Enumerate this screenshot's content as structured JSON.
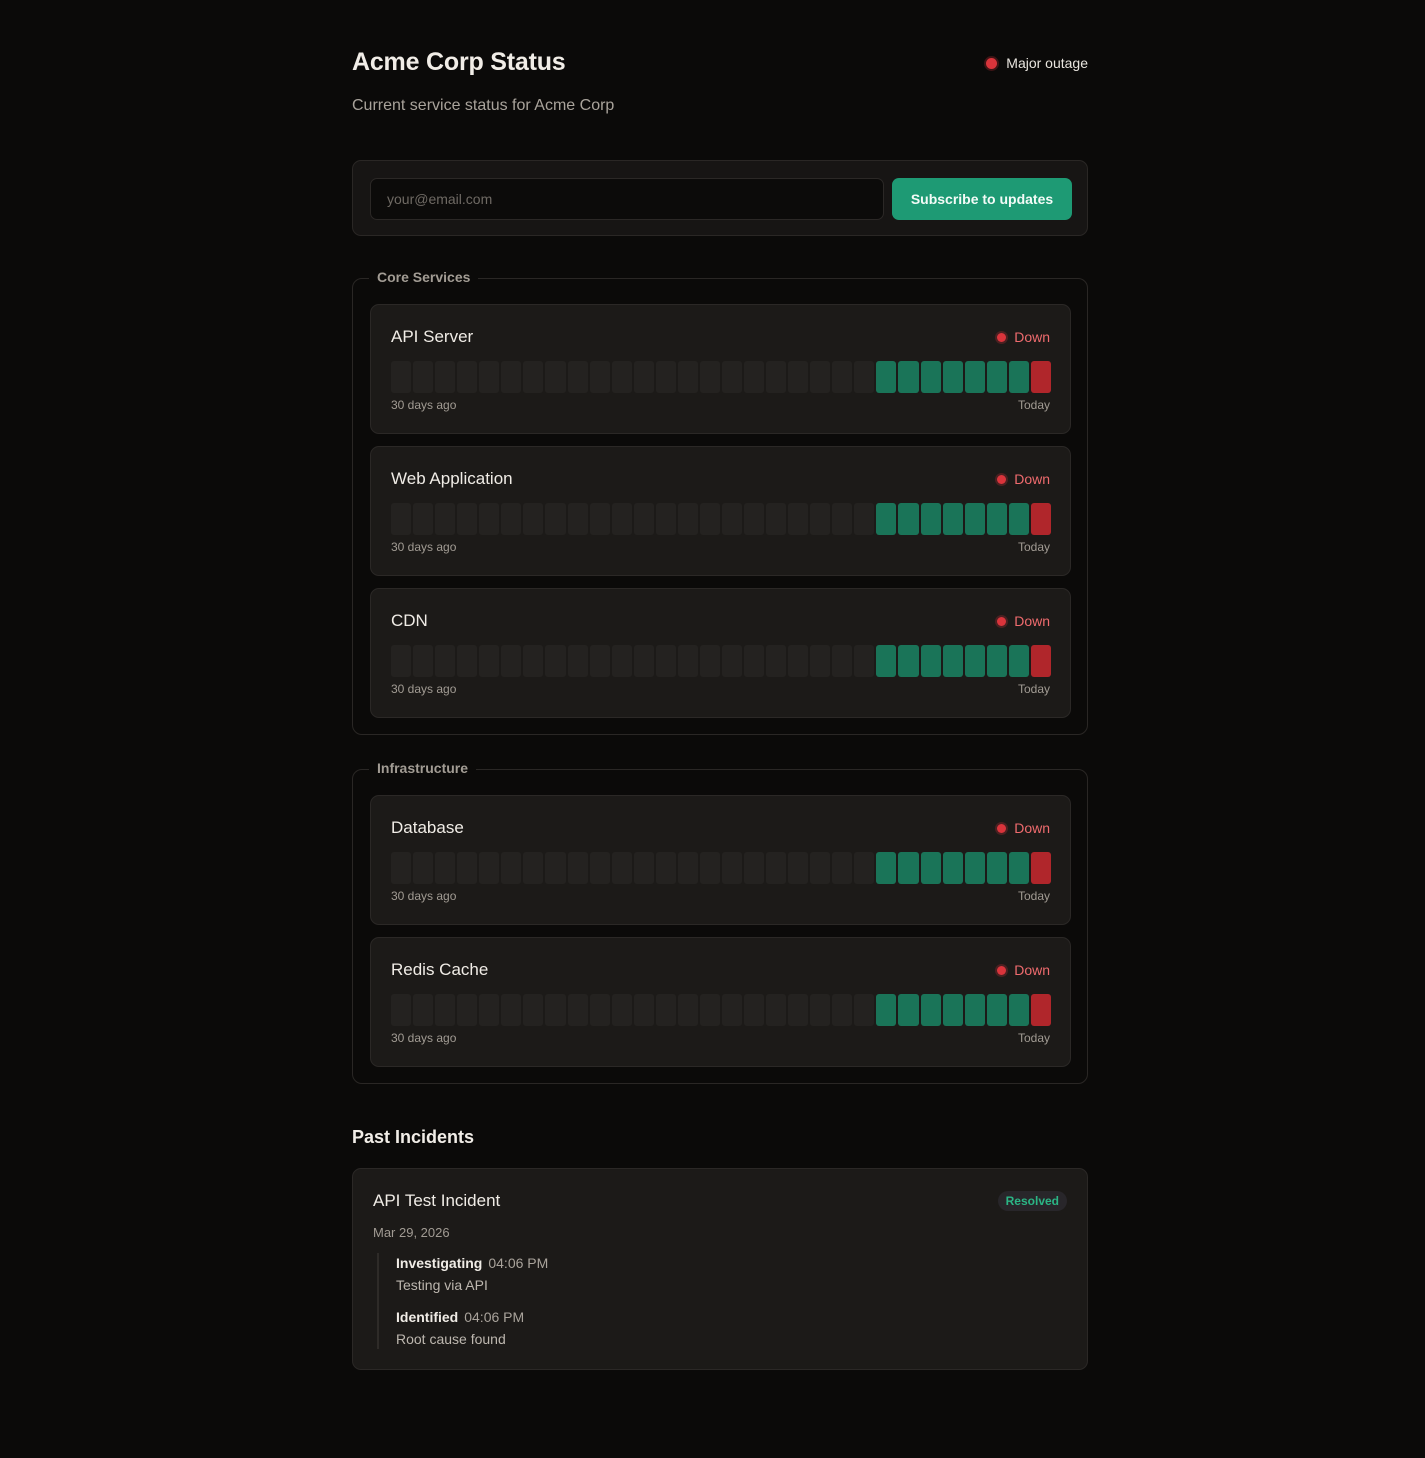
{
  "header": {
    "title": "Acme Corp Status",
    "subtitle": "Current service status for Acme Corp",
    "overall_status": "Major outage",
    "overall_color": "#d9343b"
  },
  "subscribe": {
    "placeholder": "your@email.com",
    "button_label": "Subscribe to updates"
  },
  "colors": {
    "up": "#1a7458",
    "down": "#b0262b",
    "no_data": "#242220",
    "accent": "#1e9a74"
  },
  "groups": [
    {
      "name": "Core Services",
      "services": [
        {
          "name": "API Server",
          "status": "Down",
          "history": [
            "none",
            "none",
            "none",
            "none",
            "none",
            "none",
            "none",
            "none",
            "none",
            "none",
            "none",
            "none",
            "none",
            "none",
            "none",
            "none",
            "none",
            "none",
            "none",
            "none",
            "none",
            "none",
            "up",
            "up",
            "up",
            "up",
            "up",
            "up",
            "up",
            "down"
          ],
          "axis_start": "30 days ago",
          "axis_end": "Today"
        },
        {
          "name": "Web Application",
          "status": "Down",
          "history": [
            "none",
            "none",
            "none",
            "none",
            "none",
            "none",
            "none",
            "none",
            "none",
            "none",
            "none",
            "none",
            "none",
            "none",
            "none",
            "none",
            "none",
            "none",
            "none",
            "none",
            "none",
            "none",
            "up",
            "up",
            "up",
            "up",
            "up",
            "up",
            "up",
            "down"
          ],
          "axis_start": "30 days ago",
          "axis_end": "Today"
        },
        {
          "name": "CDN",
          "status": "Down",
          "history": [
            "none",
            "none",
            "none",
            "none",
            "none",
            "none",
            "none",
            "none",
            "none",
            "none",
            "none",
            "none",
            "none",
            "none",
            "none",
            "none",
            "none",
            "none",
            "none",
            "none",
            "none",
            "none",
            "up",
            "up",
            "up",
            "up",
            "up",
            "up",
            "up",
            "down"
          ],
          "axis_start": "30 days ago",
          "axis_end": "Today"
        }
      ]
    },
    {
      "name": "Infrastructure",
      "services": [
        {
          "name": "Database",
          "status": "Down",
          "history": [
            "none",
            "none",
            "none",
            "none",
            "none",
            "none",
            "none",
            "none",
            "none",
            "none",
            "none",
            "none",
            "none",
            "none",
            "none",
            "none",
            "none",
            "none",
            "none",
            "none",
            "none",
            "none",
            "up",
            "up",
            "up",
            "up",
            "up",
            "up",
            "up",
            "down"
          ],
          "axis_start": "30 days ago",
          "axis_end": "Today"
        },
        {
          "name": "Redis Cache",
          "status": "Down",
          "history": [
            "none",
            "none",
            "none",
            "none",
            "none",
            "none",
            "none",
            "none",
            "none",
            "none",
            "none",
            "none",
            "none",
            "none",
            "none",
            "none",
            "none",
            "none",
            "none",
            "none",
            "none",
            "none",
            "up",
            "up",
            "up",
            "up",
            "up",
            "up",
            "up",
            "down"
          ],
          "axis_start": "30 days ago",
          "axis_end": "Today"
        }
      ]
    }
  ],
  "past_incidents": {
    "title": "Past Incidents",
    "items": [
      {
        "title": "API Test Incident",
        "badge": "Resolved",
        "date": "Mar 29, 2026",
        "updates": [
          {
            "status": "Investigating",
            "time": "04:06 PM",
            "message": "Testing via API"
          },
          {
            "status": "Identified",
            "time": "04:06 PM",
            "message": "Root cause found"
          }
        ]
      }
    ]
  }
}
